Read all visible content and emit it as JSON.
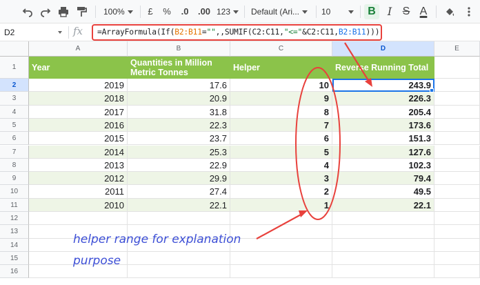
{
  "toolbar": {
    "undo_icon": "undo-icon",
    "redo_icon": "redo-icon",
    "print_icon": "print-icon",
    "paint_format_icon": "paint-format-icon",
    "zoom": "100%",
    "currency": "£",
    "percent": "%",
    "decrease_decimal": ".0",
    "increase_decimal": ".00",
    "more_formats": "123",
    "font": "Default (Ari...",
    "font_size": "10",
    "bold": "B",
    "italic": "I",
    "strikethrough": "S",
    "text_color": "A",
    "text_color_value": "#000000",
    "fill_icon": "fill-color-icon"
  },
  "formula_bar": {
    "cell_ref": "D2",
    "fx": "fx",
    "formula_parts": {
      "p1": "=ArrayFormula(If(",
      "r1": "B2:B11",
      "p2": "=",
      "s1": "\"\"",
      "p3": ",,SUMIF(C2:C11,",
      "s2": "\"<=\"",
      "p4": "&C2:C11,",
      "r2": "B2:B11",
      "p5": ")))"
    }
  },
  "columns": [
    "A",
    "B",
    "C",
    "D",
    "E"
  ],
  "selected_column": "D",
  "row_numbers": [
    "1",
    "2",
    "3",
    "4",
    "5",
    "6",
    "7",
    "8",
    "9",
    "10",
    "11",
    "12",
    "13",
    "14",
    "15",
    "16"
  ],
  "selected_row": "2",
  "table": {
    "headers": {
      "a": "Year",
      "b1": "Quantities in Million",
      "b2": "Metric Tonnes",
      "c": "Helper",
      "d": "Reverse Running Total"
    },
    "rows": [
      {
        "year": "2019",
        "qty": "17.6",
        "helper": "10",
        "total": "243.9"
      },
      {
        "year": "2018",
        "qty": "20.9",
        "helper": "9",
        "total": "226.3"
      },
      {
        "year": "2017",
        "qty": "31.8",
        "helper": "8",
        "total": "205.4"
      },
      {
        "year": "2016",
        "qty": "22.3",
        "helper": "7",
        "total": "173.6"
      },
      {
        "year": "2015",
        "qty": "23.7",
        "helper": "6",
        "total": "151.3"
      },
      {
        "year": "2014",
        "qty": "25.3",
        "helper": "5",
        "total": "127.6"
      },
      {
        "year": "2013",
        "qty": "22.9",
        "helper": "4",
        "total": "102.3"
      },
      {
        "year": "2012",
        "qty": "29.9",
        "helper": "3",
        "total": "79.4"
      },
      {
        "year": "2011",
        "qty": "27.4",
        "helper": "2",
        "total": "49.5"
      },
      {
        "year": "2010",
        "qty": "22.1",
        "helper": "1",
        "total": "22.1"
      }
    ]
  },
  "colors": {
    "header_green": "#8bc34a",
    "band_green": "#eef5e6",
    "annotation_red": "#e8413c",
    "annotation_blue": "#3d4fd6",
    "selection_blue": "#1a73e8"
  },
  "annotation": {
    "line1": "helper range for explanation",
    "line2": "purpose"
  }
}
